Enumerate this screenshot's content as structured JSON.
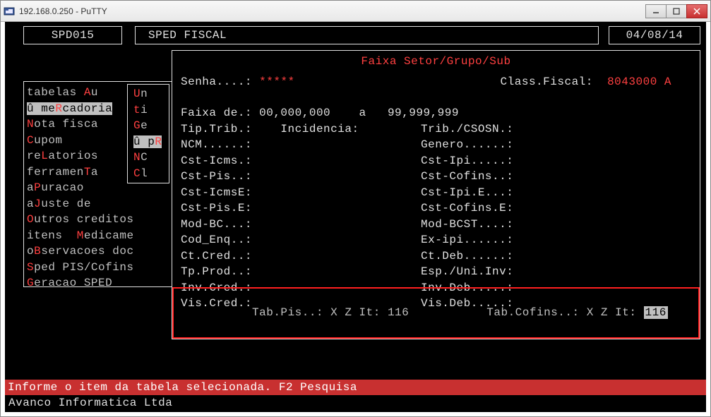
{
  "window": {
    "title": "192.168.0.250 - PuTTY"
  },
  "header": {
    "code": "SPD015",
    "title": "SPED FISCAL",
    "date": "04/08/14"
  },
  "left_menu": {
    "items": [
      {
        "pre": "tabelas ",
        "key": "A",
        "post": "u"
      },
      {
        "pre": "û me",
        "key": "R",
        "post": "cadoria",
        "selected": true
      },
      {
        "pre": "",
        "key": "N",
        "post": "ota fisca"
      },
      {
        "pre": "",
        "key": "C",
        "post": "upom"
      },
      {
        "pre": "re",
        "key": "L",
        "post": "atorios"
      },
      {
        "pre": "ferramen",
        "key": "T",
        "post": "a"
      },
      {
        "pre": "a",
        "key": "P",
        "post": "uracao"
      },
      {
        "pre": "a",
        "key": "J",
        "post": "uste de"
      },
      {
        "pre": "",
        "key": "O",
        "post": "utros creditos"
      },
      {
        "pre": "itens  ",
        "key": "M",
        "post": "edicame"
      },
      {
        "pre": "o",
        "key": "B",
        "post": "servacoes doc"
      },
      {
        "pre": "",
        "key": "S",
        "post": "ped PIS/Cofins"
      },
      {
        "pre": "",
        "key": "G",
        "post": "eracao SPED"
      }
    ]
  },
  "sub_menu": {
    "items": [
      {
        "pre": "",
        "key": "U",
        "post": "n"
      },
      {
        "pre": "",
        "key": "t",
        "post": "i"
      },
      {
        "pre": "",
        "key": "G",
        "post": "e"
      },
      {
        "pre": "û p",
        "key": "R",
        "post": "",
        "selected": true
      },
      {
        "pre": "",
        "key": "N",
        "post": "C"
      },
      {
        "pre": "",
        "key": "C",
        "post": "l"
      }
    ]
  },
  "panel": {
    "title": "Faixa Setor/Grupo/Sub",
    "senha_label": "Senha....:",
    "senha_value": "*****",
    "class_fiscal_label": "Class.Fiscal:",
    "class_fiscal_value": "8043000 A",
    "rows": [
      {
        "l1": "Faixa de.:",
        "v1": "00,000,000    a   99,999,999",
        "l2": "",
        "v2": ""
      },
      {
        "l1": "Tip.Trib.:",
        "v1": "   Incidencia:",
        "l2": "Trib./CSOSN.:",
        "v2": ""
      },
      {
        "l1": "NCM......:",
        "v1": "",
        "l2": "Genero......:",
        "v2": ""
      },
      {
        "l1": "Cst-Icms.:",
        "v1": "",
        "l2": "Cst-Ipi.....:",
        "v2": ""
      },
      {
        "l1": "Cst-Pis..:",
        "v1": "",
        "l2": "Cst-Cofins..:",
        "v2": ""
      },
      {
        "l1": "Cst-IcmsE:",
        "v1": "",
        "l2": "Cst-Ipi.E...:",
        "v2": ""
      },
      {
        "l1": "Cst-Pis.E:",
        "v1": "",
        "l2": "Cst-Cofins.E:",
        "v2": ""
      },
      {
        "l1": "Mod-BC...:",
        "v1": "",
        "l2": "Mod-BCST....:",
        "v2": ""
      },
      {
        "l1": "Cod_Enq..:",
        "v1": "",
        "l2": "Ex-ipi......:",
        "v2": ""
      },
      {
        "l1": "Ct.Cred..:",
        "v1": "",
        "l2": "Ct.Deb......:",
        "v2": ""
      },
      {
        "l1": "Tp.Prod..:",
        "v1": "",
        "l2": "Esp./Uni.Inv:",
        "v2": ""
      },
      {
        "l1": "Inv.Cred.:",
        "v1": "",
        "l2": "Inv.Deb.....:",
        "v2": ""
      },
      {
        "l1": "Vis.Cred.:",
        "v1": "",
        "l2": "Vis.Deb.....:",
        "v2": ""
      }
    ],
    "highlight": {
      "l1": "Tab.Pis..:",
      "v1": "X Z It: 116",
      "l2": "Tab.Cofins..:",
      "v2": "X Z It:",
      "v2b": "116"
    }
  },
  "status": "Informe o item da tabela selecionada. F2 Pesquisa",
  "footer": "Avanco Informatica Ltda"
}
